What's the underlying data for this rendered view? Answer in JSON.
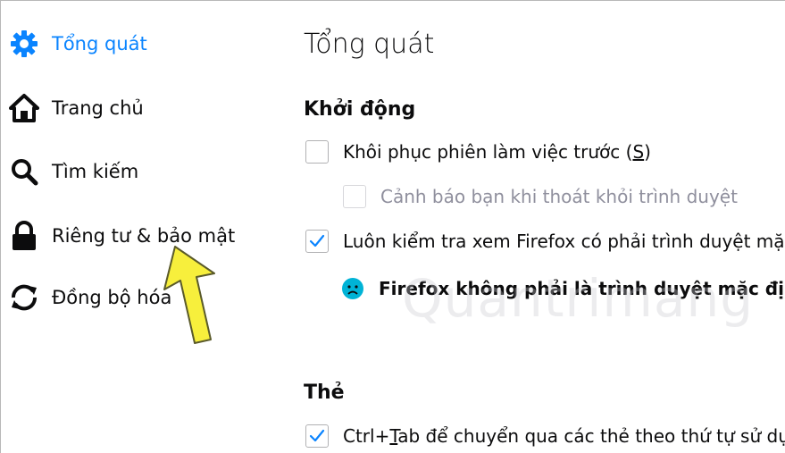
{
  "sidebar": {
    "items": [
      {
        "label": "Tổng quát",
        "icon": "gear-icon",
        "selected": true
      },
      {
        "label": "Trang chủ",
        "icon": "home-icon"
      },
      {
        "label": "Tìm kiếm",
        "icon": "search-icon"
      },
      {
        "label": "Riêng tư & bảo mật",
        "icon": "lock-icon"
      },
      {
        "label": "Đồng bộ hóa",
        "icon": "sync-icon"
      }
    ]
  },
  "main": {
    "title": "Tổng quát",
    "startup": {
      "heading": "Khởi động",
      "restore_session": {
        "label_pre": "Khôi phục phiên làm việc trước (",
        "label_accel": "S",
        "label_post": ")",
        "checked": false
      },
      "warn_on_quit": {
        "label": "Cảnh báo bạn khi thoát khỏi trình duyệt",
        "checked": false,
        "disabled": true
      },
      "check_default": {
        "label": "Luôn kiểm tra xem Firefox có phải trình duyệt mặc",
        "checked": true
      },
      "default_status": {
        "label": "Firefox không phải là trình duyệt mặc định",
        "icon": "sad-face-icon"
      }
    },
    "tabs": {
      "heading": "Thẻ",
      "ctrl_tab": {
        "label_pre": "Ctrl+",
        "label_accel": "T",
        "label_post": "ab để chuyển qua các thẻ theo thứ tự sử dụng",
        "checked": true
      }
    }
  },
  "watermark": "Quantrimang",
  "colors": {
    "accent": "#0a84ff",
    "arrow_fill": "#f7ef3c",
    "arrow_stroke": "#5a5a2a"
  }
}
